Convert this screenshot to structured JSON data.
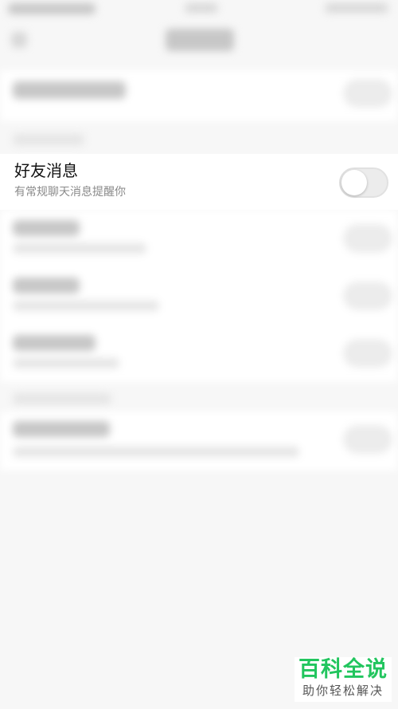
{
  "row": {
    "title": "好友消息",
    "subtitle": "有常规聊天消息提醒你",
    "toggle_on": false
  },
  "watermark": {
    "main": "百科全说",
    "sub": "助你轻松解决"
  },
  "colors": {
    "background": "#f7f7f7",
    "row_bg": "#ffffff",
    "watermark_green": "#22c55e",
    "subtitle_gray": "#8a8a8a"
  },
  "icons": [
    "back-arrow-icon"
  ]
}
